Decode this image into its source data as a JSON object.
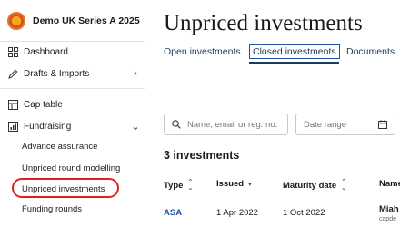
{
  "sidebar": {
    "company_name": "Demo UK Series A 2025",
    "items": [
      {
        "label": "Dashboard",
        "icon": "dashboard-icon"
      },
      {
        "label": "Drafts & Imports",
        "icon": "pencil-icon"
      },
      {
        "label": "Cap table",
        "icon": "table-icon"
      },
      {
        "label": "Fundraising",
        "icon": "chart-icon"
      }
    ],
    "fundraising_sub": [
      {
        "label": "Advance assurance"
      },
      {
        "label": "Unpriced round modelling"
      },
      {
        "label": "Unpriced investments"
      },
      {
        "label": "Funding rounds"
      }
    ]
  },
  "main": {
    "title": "Unpriced investments",
    "tabs": [
      {
        "label": "Open investments"
      },
      {
        "label": "Closed investments"
      },
      {
        "label": "Documents"
      }
    ],
    "search_placeholder": "Name, email or reg. no.",
    "date_placeholder": "Date range",
    "count": "3 investments",
    "columns": [
      "Type",
      "Issued",
      "Maturity date",
      "Name"
    ],
    "row": {
      "type": "ASA",
      "issued": "1 Apr 2022",
      "maturity": "1 Oct 2022",
      "name": "Miah",
      "name_sub": "capde"
    }
  },
  "colors": {
    "accent": "#1e56a0",
    "highlight_ring": "#e0201a"
  }
}
